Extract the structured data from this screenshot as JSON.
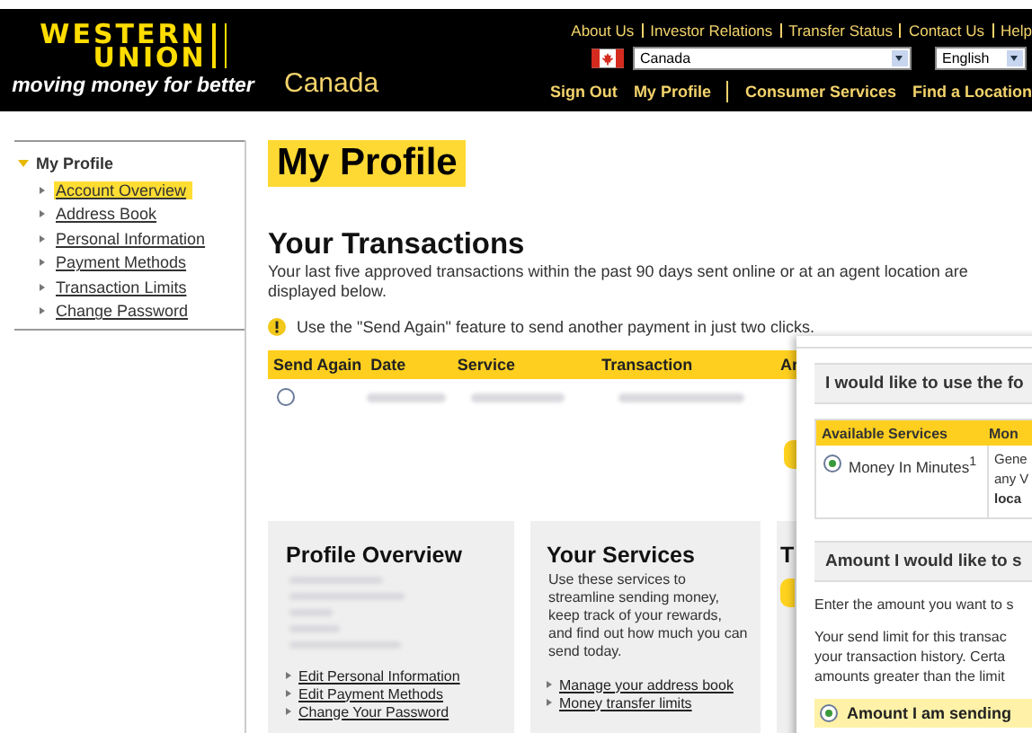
{
  "header": {
    "logo": {
      "lines": [
        "WESTERN",
        "UNION"
      ],
      "tagline": "moving money for better"
    },
    "country": "Canada",
    "top_links": [
      "About Us",
      "Investor Relations",
      "Transfer Status",
      "Contact Us",
      "Help"
    ],
    "country_select": {
      "value": "Canada"
    },
    "language_select": {
      "value": "English"
    },
    "nav": [
      "Sign Out",
      "My Profile",
      "Consumer Services",
      "Find a Location"
    ]
  },
  "sidebar": {
    "title": "My Profile",
    "expanded": true,
    "items": [
      {
        "label": "Account Overview",
        "selected": true
      },
      {
        "label": "Address Book",
        "selected": false
      },
      {
        "label": "Personal Information",
        "selected": false
      },
      {
        "label": "Payment Methods",
        "selected": false
      },
      {
        "label": "Transaction Limits",
        "selected": false
      },
      {
        "label": "Change Password",
        "selected": false
      }
    ]
  },
  "page_title": "My Profile",
  "transactions": {
    "title": "Your Transactions",
    "description": "Your last five approved transactions within the past 90 days sent online or at an agent location are displayed below.",
    "tip": "Use the \"Send Again\" feature to send another payment in just two clicks.",
    "columns": [
      "Send Again",
      "Date",
      "Service",
      "Transaction",
      "Ar"
    ],
    "rows": [
      {
        "selected": false
      }
    ]
  },
  "cards": [
    {
      "title": "Profile Overview",
      "links": [
        "Edit Personal Information",
        "Edit Payment Methods",
        "Change Your Password"
      ]
    },
    {
      "title": "Your Services",
      "text": "Use these services to streamline sending money, keep track of your rewards, and find out how much you can send today.",
      "links": [
        "Manage your address book",
        "Money transfer limits"
      ]
    },
    {
      "title": "T"
    }
  ],
  "send_panel": {
    "service_heading": "I would like to use the fo",
    "columns": [
      "Available Services",
      "Mon"
    ],
    "services": [
      {
        "name": "Money In Minutes$^{1}$",
        "selected": true,
        "description": [
          "Gene",
          "any V",
          "**loca**"
        ]
      }
    ],
    "amount_heading": "Amount I would like to s",
    "amount_intro": "Enter the amount you want to s",
    "limit_note": [
      "Your send limit for this transac",
      "your transaction history. Certa",
      "amounts greater than the limit"
    ],
    "amount_option": {
      "label": "Amount I am sending",
      "selected": true
    }
  }
}
